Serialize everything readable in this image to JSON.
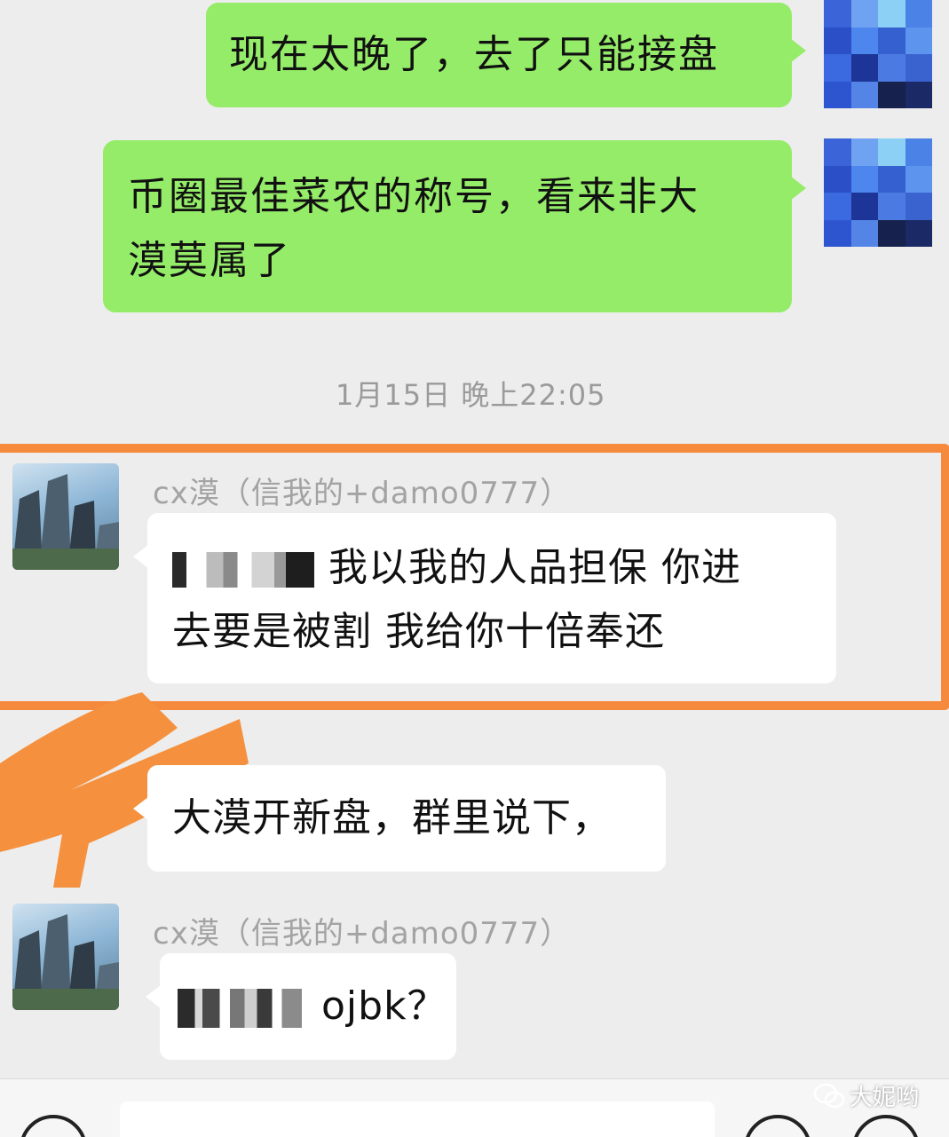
{
  "messages_out": [
    {
      "line1": "现在太晚了，去了只能接盘"
    },
    {
      "line1": "币圈最佳菜农的称号，看来非大",
      "line2": "漠莫属了"
    }
  ],
  "timestamp": "1月15日 晚上22:05",
  "incoming": [
    {
      "sender": "cx漠（信我的+damo0777）",
      "line1": "我以我的人品担保 你进",
      "line2": "去要是被割 我给你十倍奉还"
    },
    {
      "line1": "大漠开新盘，群里说下，"
    },
    {
      "sender": "cx漠（信我的+damo0777）",
      "line1": "ojbk？"
    }
  ],
  "watermark": "大妮哟",
  "icons": {
    "voice": "voice-icon",
    "emoji": "emoji-icon",
    "plus": "plus-icon",
    "wechat": "wechat-logo-icon"
  },
  "colors": {
    "out_bubble": "#95ec69",
    "in_bubble": "#ffffff",
    "highlight": "#f58a3c",
    "background": "#ededed"
  }
}
